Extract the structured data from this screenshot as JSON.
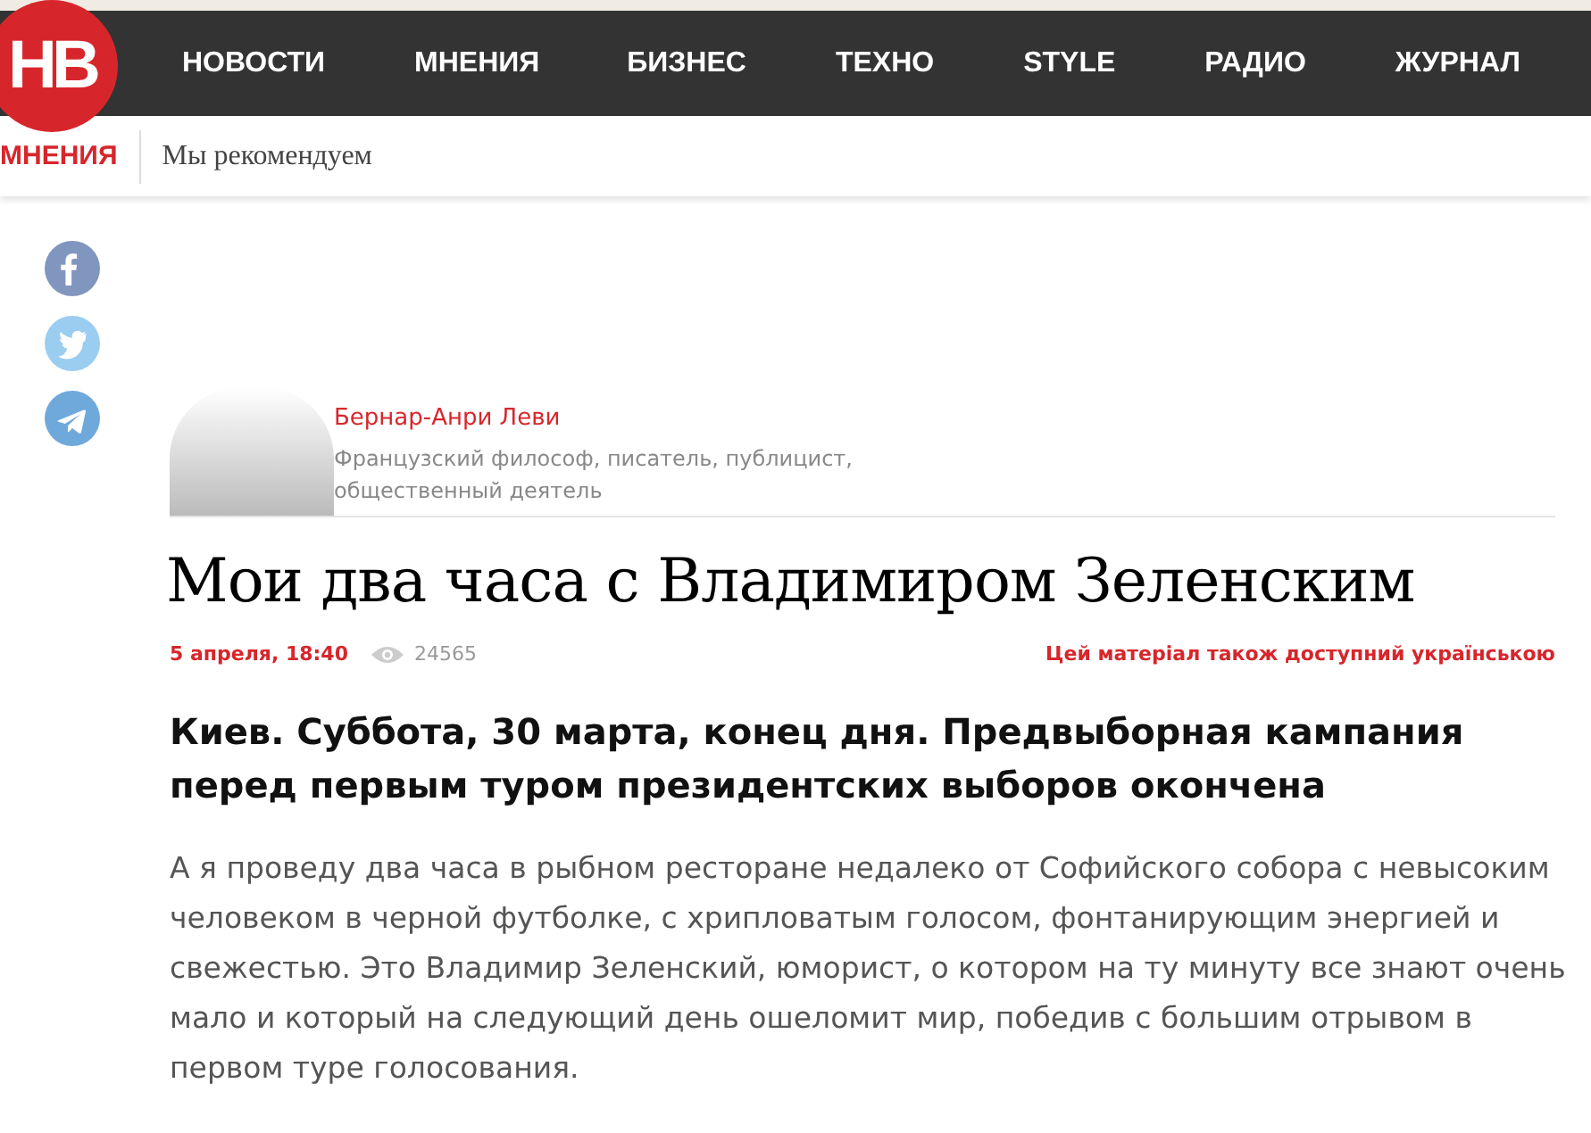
{
  "logo": {
    "text": "НВ"
  },
  "nav": [
    {
      "label": "НОВОСТИ",
      "selected": false
    },
    {
      "label": "МНЕНИЯ",
      "selected": false
    },
    {
      "label": "БИЗНЕС",
      "selected": false
    },
    {
      "label": "ТЕХНО",
      "selected": false
    },
    {
      "label": "STYLE",
      "selected": false
    },
    {
      "label": "РАДИО",
      "selected": false
    },
    {
      "label": "ЖУРНАЛ",
      "selected": false
    }
  ],
  "subnav": {
    "section": "МНЕНИЯ",
    "link": "Мы рекомендуем"
  },
  "share": [
    {
      "kind": "facebook"
    },
    {
      "kind": "twitter"
    },
    {
      "kind": "telegram"
    }
  ],
  "author": {
    "name": "Бернар-Анри Леви",
    "bio": "Французский философ, писатель, публицист, общественный деятель"
  },
  "article": {
    "title": "Мои два часа с Владимиром Зеленским",
    "date": "5 апреля, 18:40",
    "views": "24565",
    "translation_link": "Цей матеріал також доступний українською",
    "lead": "Киев. Суббота, 30 марта, конец дня. Предвыборная кампания перед первым туром президентских выборов окончена",
    "body": "А я проведу два часа в рыбном ресторане недалеко от Софийского собора с невысоким человеком в черной футболке, с хрипловатым голосом, фонтанирующим энергией и свежестью. Это Владимир Зеленский, юморист, о котором на ту минуту все знают очень мало и который на следующий день ошеломит мир, победив с большим отрывом в первом туре голосования."
  }
}
